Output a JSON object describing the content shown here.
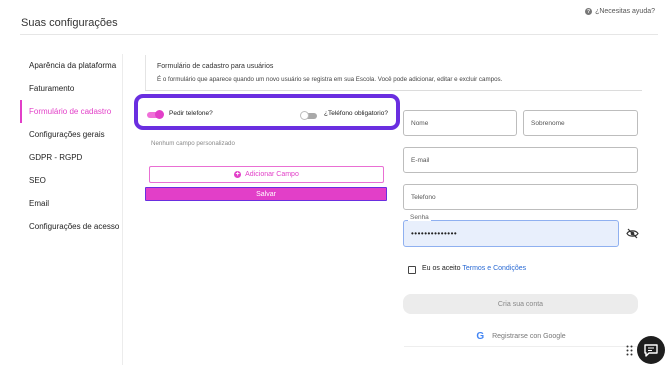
{
  "header": {
    "title": "Suas configurações",
    "help_label": "¿Necesitas ayuda?"
  },
  "sidebar": {
    "items": [
      {
        "label": "Aparência da plataforma",
        "active": false
      },
      {
        "label": "Faturamento",
        "active": false
      },
      {
        "label": "Formulário de cadastro",
        "active": true
      },
      {
        "label": "Configurações gerais",
        "active": false
      },
      {
        "label": "GDPR - RGPD",
        "active": false
      },
      {
        "label": "SEO",
        "active": false
      },
      {
        "label": "Email",
        "active": false
      },
      {
        "label": "Configurações de acesso",
        "active": false
      }
    ]
  },
  "form_settings": {
    "title": "Formulário de cadastro para usuários",
    "description": "É o formulário que aparece quando um novo usuário se registra em sua Escola. Você pode adicionar, editar e excluir campos.",
    "toggle_phone": {
      "label": "Pedir telefone?",
      "on": true
    },
    "toggle_phone_required": {
      "label": "¿Teléfono obligatorio?",
      "on": false
    },
    "empty_note": "Nenhum campo personalizado",
    "add_field_label": "Adicionar Campo",
    "save_label": "Salvar"
  },
  "preview": {
    "name_placeholder": "Nome",
    "surname_placeholder": "Sobrenome",
    "email_placeholder": "E-mail",
    "phone_placeholder": "Telefono",
    "password_label": "Senha",
    "password_value": "••••••••••••••",
    "terms_prefix": "Eu os aceito",
    "terms_link": "Termos e Condições",
    "create_account_label": "Cria sua conta",
    "google_label": "Registrarse con Google"
  },
  "colors": {
    "accent": "#e23fc8",
    "highlight": "#6a2ee0",
    "link": "#2a6ad4"
  },
  "icons": {
    "help": "question-circle-icon",
    "add": "plus-circle-icon",
    "eye": "eye-off-icon",
    "google": "google-icon",
    "chat": "chat-bubble-icon",
    "dots": "grid-dots-icon"
  }
}
